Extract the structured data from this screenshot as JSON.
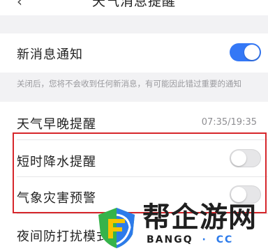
{
  "header": {
    "title": "天气消息提醒",
    "back_icon": "chevron-left-icon"
  },
  "settings": {
    "new_message": {
      "label": "新消息通知",
      "enabled": true
    },
    "note": "关闭后，您将不会收到任何新消息，有可能因此错过重要的通知",
    "weather_reminder": {
      "label": "天气早晚提醒",
      "value": "07:35/19:35"
    },
    "rain_alert": {
      "label": "短时降水提醒",
      "enabled": false
    },
    "disaster_alert": {
      "label": "气象灾害预警",
      "enabled": false
    },
    "night_mode": {
      "label": "夜间防打扰模式"
    }
  },
  "colors": {
    "toggle_on": "#3478f6",
    "highlight_border": "#d6262b",
    "watermark_accent": "#2d7bea"
  },
  "watermark": {
    "title": "帮企游网",
    "sub": "BANGQ",
    "sub_dot": "·",
    "sub_cc": "CC"
  }
}
